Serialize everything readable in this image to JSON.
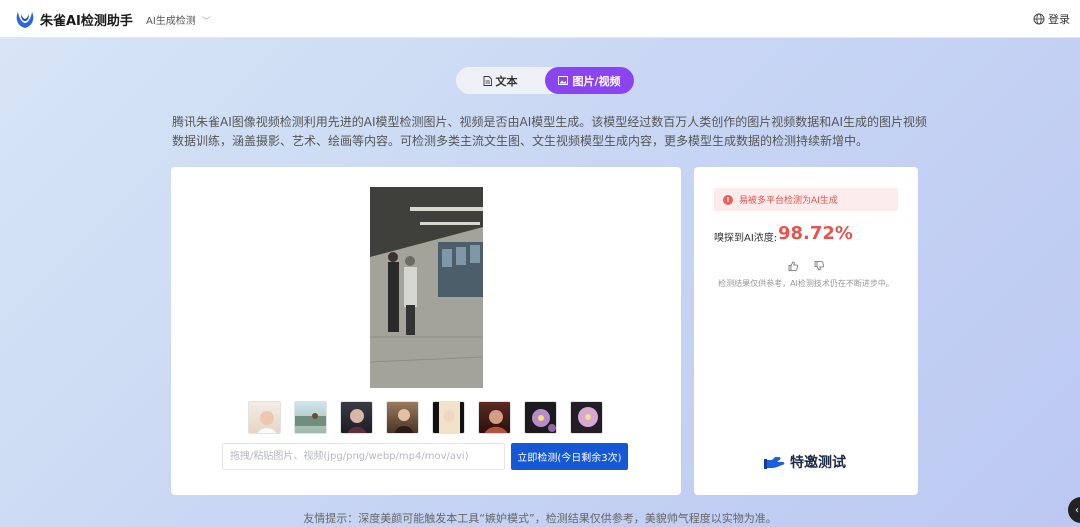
{
  "header": {
    "brand": "朱雀AI检测助手",
    "nav_select": "AI生成检测",
    "login": "登录"
  },
  "tabs": [
    {
      "label": "文本",
      "active": false
    },
    {
      "label": "图片/视频",
      "active": true
    }
  ],
  "description": "腾讯朱雀AI图像视频检测利用先进的AI模型检测图片、视频是否由AI模型生成。该模型经过数百万人类创作的图片视频数据和AI生成的图片视频数据训练，涵盖摄影、艺术、绘画等内容。可检测多类主流文生图、文生视频模型生成内容，更多模型生成数据的检测持续新增中。",
  "upload": {
    "placeholder": "拖拽/粘贴图片、视频(jpg/png/webp/mp4/mov/avi)",
    "value": "",
    "button": "立即检测(今日剩余3次)"
  },
  "thumbnails": [
    "thumb-1",
    "thumb-2",
    "thumb-3",
    "thumb-4",
    "thumb-5",
    "thumb-6",
    "thumb-7",
    "thumb-8"
  ],
  "result": {
    "alert": "易被多平台检测为AI生成",
    "score_label": "嗅探到AI浓度:",
    "score": "98.72%",
    "disclaimer": "检测结果仅供参考，AI检测技术仍在不断进步中。",
    "special_label": "特邀测试"
  },
  "footer": {
    "tip": "友情提示：深度美颜可能触发本工具“嫉妒模式”，检测结果仅供参考，美貌帅气程度以实物为准。"
  },
  "colors": {
    "accent_purple": "#8a45f0",
    "button_blue": "#1558d6",
    "alert_red": "#e5554d"
  }
}
